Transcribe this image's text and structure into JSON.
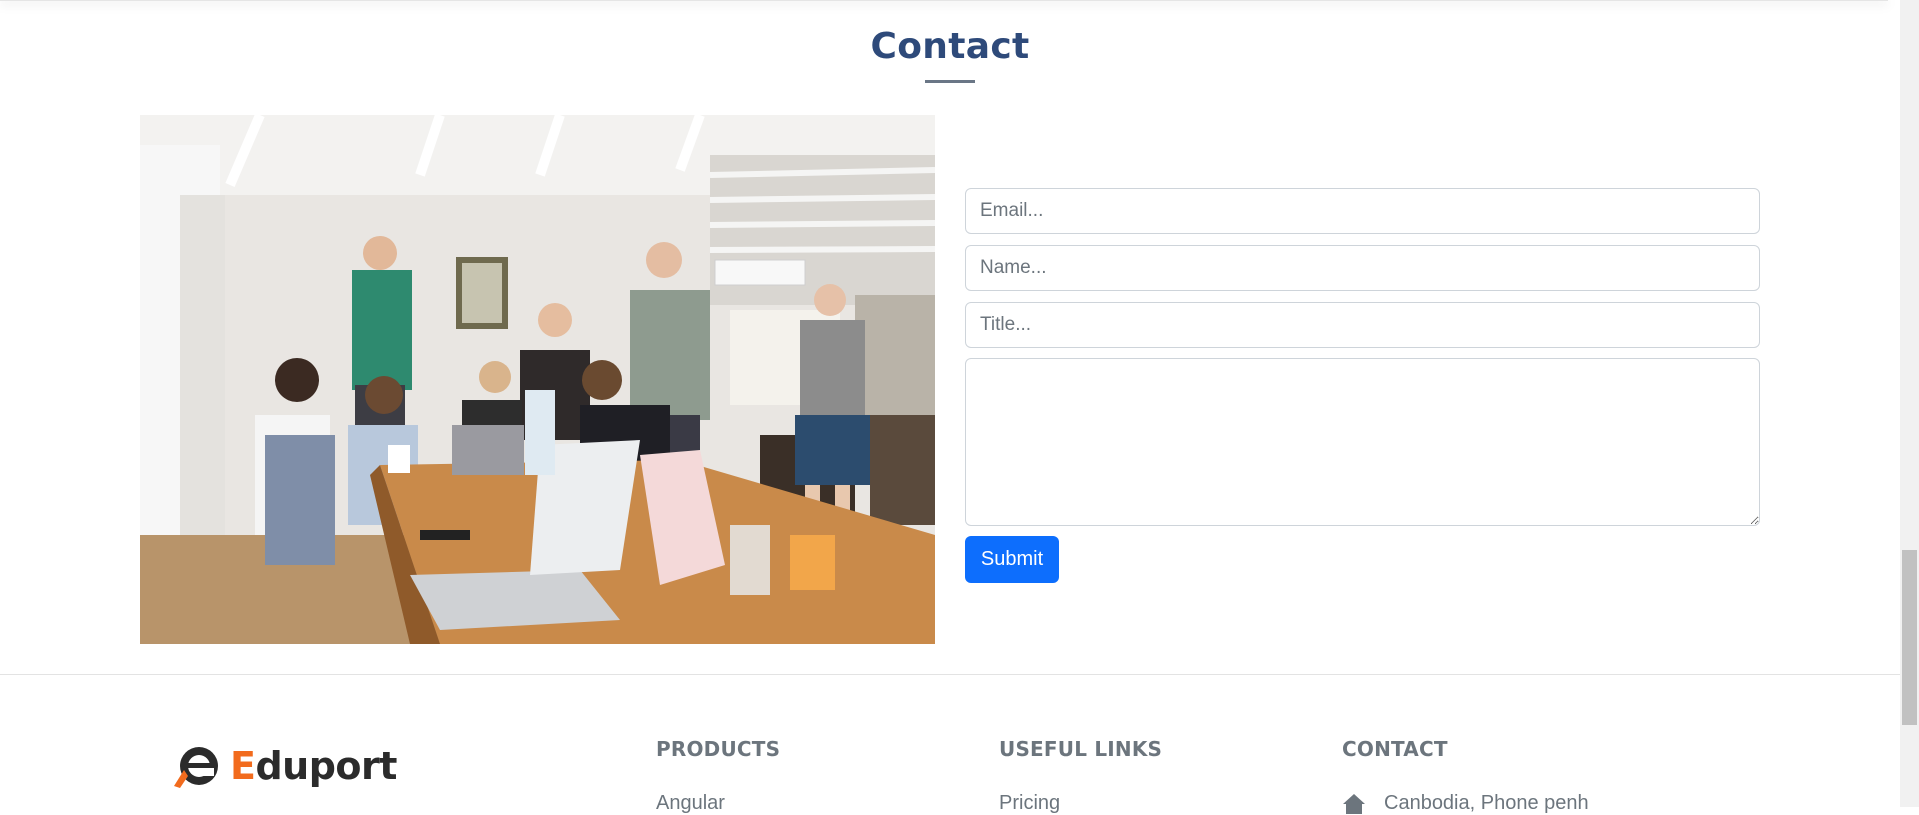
{
  "section": {
    "title": "Contact"
  },
  "form": {
    "email_placeholder": "Email...",
    "name_placeholder": "Name...",
    "title_placeholder": "Title...",
    "message_placeholder": "",
    "submit_label": "Submit"
  },
  "footer": {
    "logo": {
      "letter": "E",
      "rest": "duport"
    },
    "columns": [
      {
        "heading": "PRODUCTS",
        "first_link": "Angular"
      },
      {
        "heading": "USEFUL LINKS",
        "first_link": "Pricing"
      },
      {
        "heading": "CONTACT",
        "first_item": "Canbodia, Phone penh",
        "first_item_icon": "home-icon"
      }
    ]
  },
  "colors": {
    "title": "#2e4a7a",
    "submit_button": "#0d6efd",
    "logo_accent": "#f26b1d",
    "footer_text": "#6c757d"
  }
}
